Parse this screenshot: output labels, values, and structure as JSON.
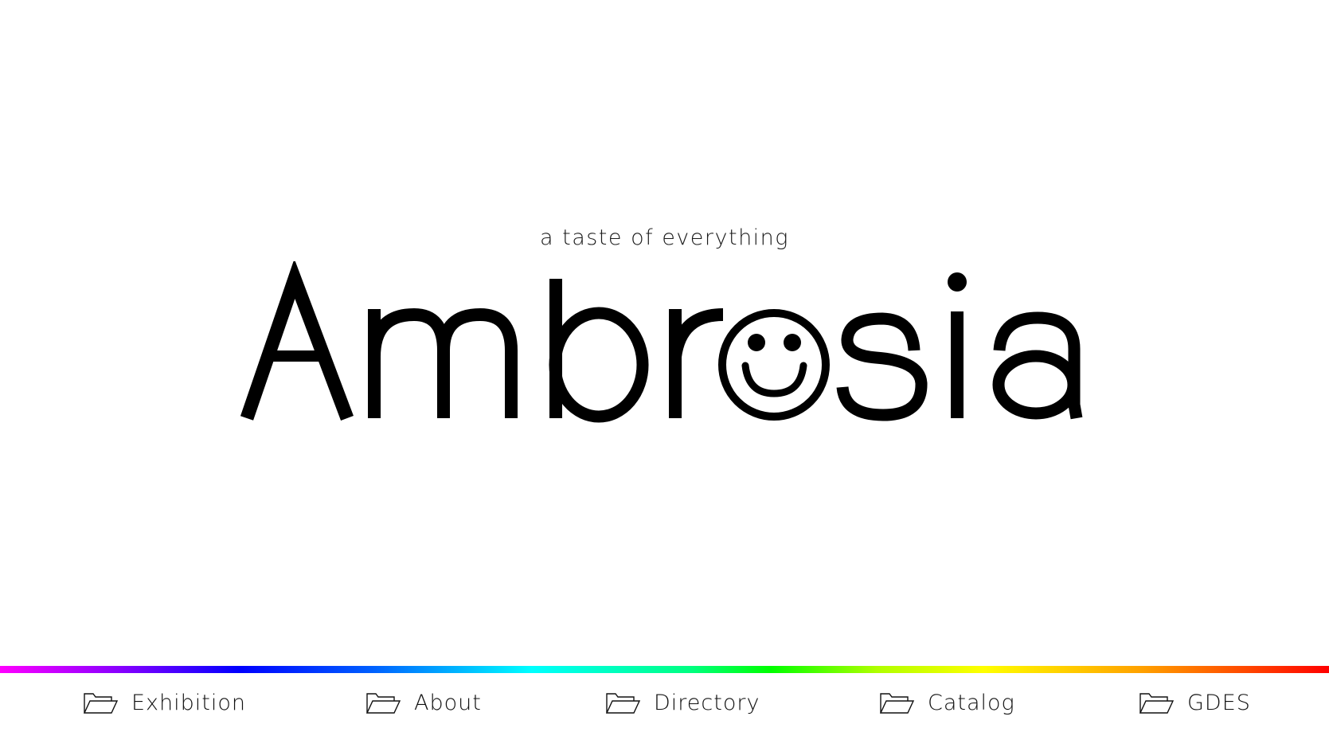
{
  "hero": {
    "tagline": "a taste of everything",
    "logo_text": "Ambrosia",
    "logo_letter_face": "smiley-face-icon"
  },
  "divider": {
    "colors": [
      "#ff00ff",
      "#0000ff",
      "#00ffff",
      "#00ff00",
      "#ffff00",
      "#ff0000"
    ]
  },
  "nav": {
    "items": [
      {
        "label": "Exhibition",
        "icon": "folder-icon"
      },
      {
        "label": "About",
        "icon": "folder-icon"
      },
      {
        "label": "Directory",
        "icon": "folder-icon"
      },
      {
        "label": "Catalog",
        "icon": "folder-icon"
      },
      {
        "label": "GDES",
        "icon": "folder-icon"
      }
    ]
  }
}
